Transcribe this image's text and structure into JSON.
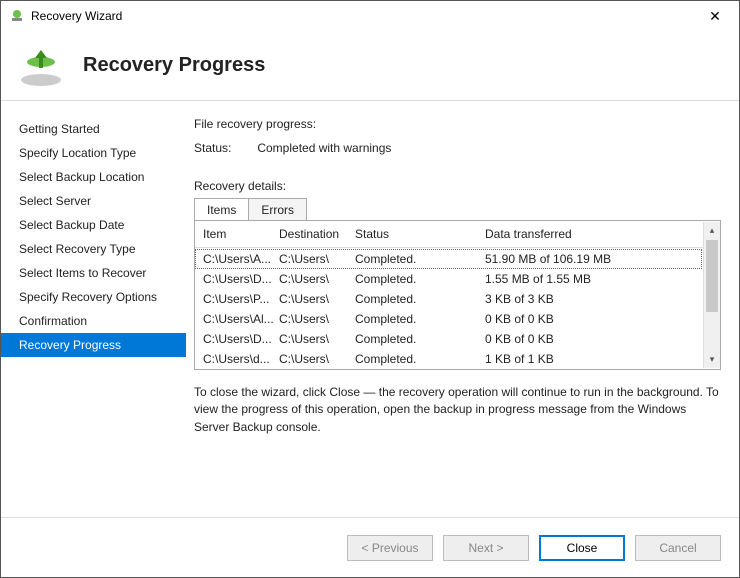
{
  "window": {
    "title": "Recovery Wizard"
  },
  "header": {
    "title": "Recovery Progress"
  },
  "sidebar": {
    "items": [
      {
        "label": "Getting Started"
      },
      {
        "label": "Specify Location Type"
      },
      {
        "label": "Select Backup Location"
      },
      {
        "label": "Select Server"
      },
      {
        "label": "Select Backup Date"
      },
      {
        "label": "Select Recovery Type"
      },
      {
        "label": "Select Items to Recover"
      },
      {
        "label": "Specify Recovery Options"
      },
      {
        "label": "Confirmation"
      },
      {
        "label": "Recovery Progress"
      }
    ],
    "activeIndex": 9
  },
  "main": {
    "progressLabel": "File recovery progress:",
    "statusLabel": "Status:",
    "statusValue": "Completed with warnings",
    "detailsLabel": "Recovery details:",
    "tabs": [
      {
        "label": "Items"
      },
      {
        "label": "Errors"
      }
    ],
    "activeTab": 0,
    "columns": {
      "item": "Item",
      "dest": "Destination",
      "status": "Status",
      "data": "Data transferred"
    },
    "rows": [
      {
        "item": "C:\\Users\\A...",
        "dest": "C:\\Users\\",
        "status": "Completed.",
        "data": "51.90 MB of 106.19 MB"
      },
      {
        "item": "C:\\Users\\D...",
        "dest": "C:\\Users\\",
        "status": "Completed.",
        "data": "1.55 MB of 1.55 MB"
      },
      {
        "item": "C:\\Users\\P...",
        "dest": "C:\\Users\\",
        "status": "Completed.",
        "data": "3 KB of 3 KB"
      },
      {
        "item": "C:\\Users\\Al...",
        "dest": "C:\\Users\\",
        "status": "Completed.",
        "data": "0 KB of 0 KB"
      },
      {
        "item": "C:\\Users\\D...",
        "dest": "C:\\Users\\",
        "status": "Completed.",
        "data": "0 KB of 0 KB"
      },
      {
        "item": "C:\\Users\\d...",
        "dest": "C:\\Users\\",
        "status": "Completed.",
        "data": "1 KB of 1 KB"
      }
    ],
    "hint": "To close the wizard, click Close — the recovery operation will continue to run in the background. To view the progress of this operation, open the backup in progress message from the Windows Server Backup console."
  },
  "footer": {
    "previous": "< Previous",
    "next": "Next >",
    "close": "Close",
    "cancel": "Cancel"
  }
}
